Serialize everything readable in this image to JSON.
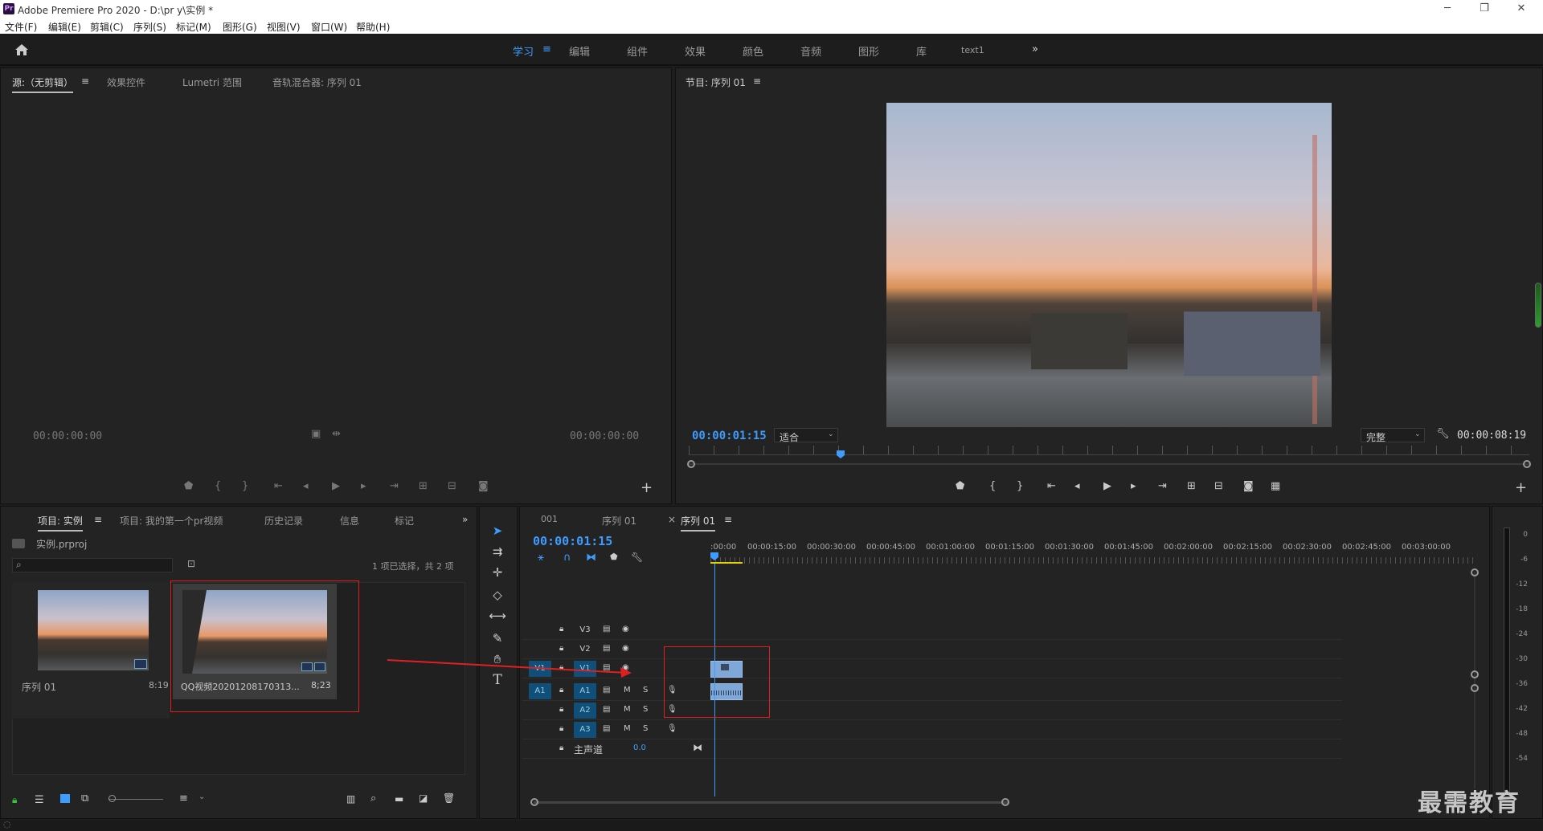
{
  "app": {
    "title": "Adobe Premiere Pro 2020 - D:\\pr y\\实例 *",
    "logo": "Pr"
  },
  "window": {
    "minimize": "─",
    "maximize": "❐",
    "close": "✕"
  },
  "menu": [
    "文件(F)",
    "编辑(E)",
    "剪辑(C)",
    "序列(S)",
    "标记(M)",
    "图形(G)",
    "视图(V)",
    "窗口(W)",
    "帮助(H)"
  ],
  "workspaces": {
    "items": [
      "学习",
      "编辑",
      "组件",
      "效果",
      "颜色",
      "音频",
      "图形",
      "库",
      "text1"
    ],
    "active": "学习",
    "menu_icon": "≡",
    "more": "»"
  },
  "source_panel": {
    "tabs": [
      "源:（无剪辑）",
      "效果控件",
      "Lumetri 范围",
      "音轨混合器: 序列 01"
    ],
    "menu_icon": "≡",
    "tc_left": "00:00:00:00",
    "tc_right": "00:00:00:00"
  },
  "program_panel": {
    "tab": "节目: 序列 01",
    "menu_icon": "≡",
    "tc_current": "00:00:01:15",
    "fit": "适合",
    "quality": "完整",
    "tc_duration": "00:00:08:19"
  },
  "project_panel": {
    "tabs": [
      "项目: 实例",
      "项目: 我的第一个pr视频",
      "历史记录",
      "信息",
      "标记"
    ],
    "menu_icon": "≡",
    "more": "»",
    "file": "实例.prproj",
    "selection": "1 项已选择，共 2 项",
    "items": [
      {
        "name": "序列 01",
        "duration": "8:19"
      },
      {
        "name": "QQ视频20201208170313...",
        "duration": "8;23"
      }
    ]
  },
  "timeline": {
    "tabs": [
      "001",
      "序列 01",
      "序列 01"
    ],
    "close": "×",
    "menu_icon": "≡",
    "timecode": "00:00:01:15",
    "ruler": [
      ":00:00",
      "00:00:15:00",
      "00:00:30:00",
      "00:00:45:00",
      "00:01:00:00",
      "00:01:15:00",
      "00:01:30:00",
      "00:01:45:00",
      "00:02:00:00",
      "00:02:15:00",
      "00:02:30:00",
      "00:02:45:00",
      "00:03:00:00"
    ],
    "video_tracks": [
      "V3",
      "V2",
      "V1"
    ],
    "audio_tracks": [
      "A1",
      "A2",
      "A3"
    ],
    "src_v": "V1",
    "src_a": "A1",
    "m": "M",
    "s": "S",
    "master": "主声道",
    "master_val": "0.0"
  },
  "meter": {
    "labels": [
      "0",
      "-6",
      "-12",
      "-18",
      "-24",
      "-30",
      "-36",
      "-42",
      "-48",
      "-54"
    ]
  },
  "watermark": "最需教育",
  "colors": {
    "accent": "#3f9cff",
    "highlight": "#e02020",
    "clip": "#7fa8d8"
  }
}
